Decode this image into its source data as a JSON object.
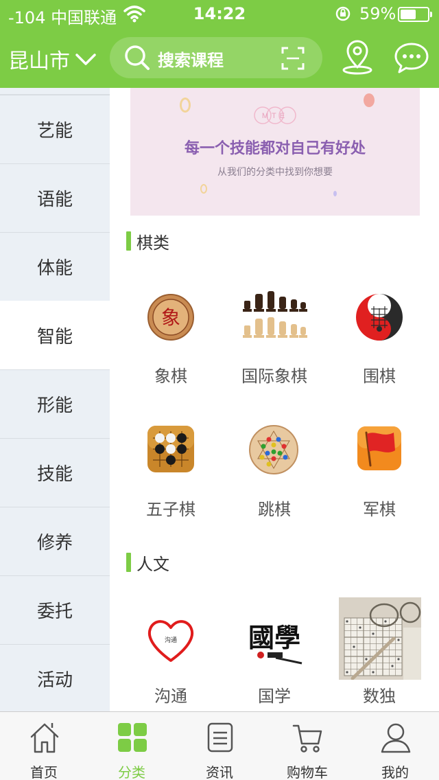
{
  "status_bar": {
    "carrier": "-104 中国联通",
    "time": "14:22",
    "battery": "59%",
    "battery_level": 0.59
  },
  "header": {
    "city": "昆山市",
    "search_placeholder": "搜索课程",
    "accent_color": "#7dcc45"
  },
  "sidebar": {
    "items": [
      {
        "label": "艺能"
      },
      {
        "label": "语能"
      },
      {
        "label": "体能"
      },
      {
        "label": "智能"
      },
      {
        "label": "形能"
      },
      {
        "label": "技能"
      },
      {
        "label": "修养"
      },
      {
        "label": "委托"
      },
      {
        "label": "活动"
      }
    ],
    "active_label": "智能"
  },
  "banner": {
    "logo": "MTE",
    "title": "每一个技能都对自己有好处",
    "subtitle": "从我们的分类中找到你想要"
  },
  "sections": [
    {
      "title": "棋类",
      "items": [
        {
          "label": "象棋",
          "icon": "chinese-chess-icon"
        },
        {
          "label": "国际象棋",
          "icon": "chess-pieces-icon"
        },
        {
          "label": "围棋",
          "icon": "go-yin-yang-icon"
        },
        {
          "label": "五子棋",
          "icon": "gomoku-icon"
        },
        {
          "label": "跳棋",
          "icon": "chinese-checkers-icon"
        },
        {
          "label": "军棋",
          "icon": "flag-icon"
        }
      ]
    },
    {
      "title": "人文",
      "items": [
        {
          "label": "沟通",
          "icon": "heart-icon",
          "icon_text": "沟通"
        },
        {
          "label": "国学",
          "icon": "guoxue-calligraphy-icon",
          "icon_text": "國學"
        },
        {
          "label": "数独",
          "icon": "sudoku-photo-icon"
        }
      ]
    }
  ],
  "tabbar": {
    "tabs": [
      {
        "label": "首页",
        "icon": "home-icon"
      },
      {
        "label": "分类",
        "icon": "grid-icon"
      },
      {
        "label": "资讯",
        "icon": "document-icon"
      },
      {
        "label": "购物车",
        "icon": "cart-icon"
      },
      {
        "label": "我的",
        "icon": "user-icon"
      }
    ],
    "active_label": "分类"
  }
}
